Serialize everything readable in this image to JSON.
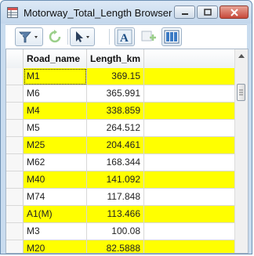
{
  "window": {
    "title": "Motorway_Total_Length Browser"
  },
  "toolbar": {
    "buttons": [
      {
        "icon": "filter-icon"
      },
      {
        "icon": "refresh-icon"
      },
      {
        "icon": "select-pointer-icon"
      },
      {
        "icon": "label-text-icon"
      },
      {
        "icon": "add-row-icon"
      },
      {
        "icon": "columns-icon"
      }
    ]
  },
  "table": {
    "columns": [
      "Road_name",
      "Length_km"
    ],
    "rows": [
      {
        "name": "M1",
        "length": "369.15",
        "highlight": true
      },
      {
        "name": "M6",
        "length": "365.991",
        "highlight": false
      },
      {
        "name": "M4",
        "length": "338.859",
        "highlight": true
      },
      {
        "name": "M5",
        "length": "264.512",
        "highlight": false
      },
      {
        "name": "M25",
        "length": "204.461",
        "highlight": true
      },
      {
        "name": "M62",
        "length": "168.344",
        "highlight": false
      },
      {
        "name": "M40",
        "length": "141.092",
        "highlight": true
      },
      {
        "name": "M74",
        "length": "117.848",
        "highlight": false
      },
      {
        "name": "A1(M)",
        "length": "113.466",
        "highlight": true
      },
      {
        "name": "M3",
        "length": "100.08",
        "highlight": false
      },
      {
        "name": "M20",
        "length": "82.5888",
        "highlight": true
      }
    ],
    "highlight_color": "#ffff00"
  }
}
